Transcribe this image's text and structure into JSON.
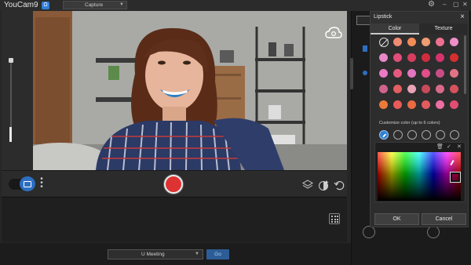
{
  "titlebar": {
    "app_name": "YouCam9",
    "app_badge": "Ω",
    "mode_label": "Capture",
    "settings_icon": "gear-icon",
    "minimize_icon": "minimize-icon",
    "restore_icon": "restore-icon",
    "close_icon": "close-icon"
  },
  "camera": {
    "zoom_level": 0.82,
    "cloud_icon": "cloud-icon"
  },
  "controls": {
    "camera_icon": "camera-icon",
    "more_icon": "more-vertical-icon",
    "record_icon": "record-icon",
    "layers_icon": "layers-icon",
    "effects_icon": "face-effect-icon",
    "undo_icon": "undo-icon"
  },
  "filmstrip": {
    "grid_icon": "grid-icon"
  },
  "bottom": {
    "device": "U Meeting",
    "go_label": "Go"
  },
  "lipstick": {
    "title": "Lipstick",
    "close": "×",
    "tabs": [
      "Color",
      "Texture"
    ],
    "active_tab": "Color",
    "swatch_colors": [
      [
        "#f08a72",
        "#f38b56",
        "#ef9c73",
        "#ee6f8f",
        "#ef8fc9"
      ],
      [
        "#e789c8",
        "#e34d7a",
        "#d83d5e",
        "#d02c3f",
        "#d6326c",
        "#d62f2f"
      ],
      [
        "#ea7ac4",
        "#e6597f",
        "#e277c0",
        "#e14e89",
        "#c94d85",
        "#e17484"
      ],
      [
        "#d0638d",
        "#e35f63",
        "#e9a2b6",
        "#c84a5a",
        "#d96a8a",
        "#d6515c"
      ],
      [
        "#ec7a38",
        "#e95b58",
        "#ea6a44",
        "#e25c5f",
        "#ec6fa0",
        "#e24d72"
      ]
    ],
    "custom_label": "Customize color (up to 6 colors)",
    "custom_slots": 6,
    "picker_tools": [
      "trash-icon",
      "check-icon",
      "close-icon"
    ],
    "ok_label": "OK",
    "cancel_label": "Cancel"
  }
}
